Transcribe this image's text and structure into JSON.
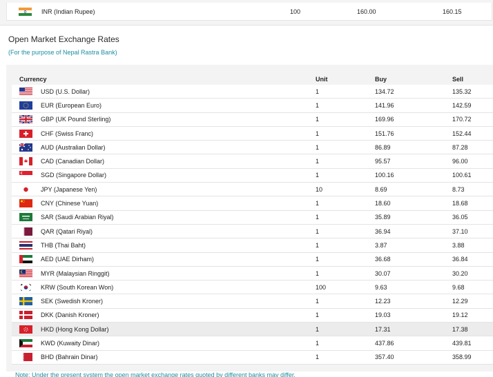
{
  "top_row": {
    "flag": "india-flag",
    "currency": "INR (Indian Rupee)",
    "unit": "100",
    "buy": "160.00",
    "sell": "160.15"
  },
  "section": {
    "title": "Open Market Exchange Rates",
    "subtitle": "(For the purpose of Nepal Rastra Bank)"
  },
  "table": {
    "headers": {
      "currency": "Currency",
      "unit": "Unit",
      "buy": "Buy",
      "sell": "Sell"
    },
    "rows": [
      {
        "flag": "usa-flag",
        "currency": "USD (U.S. Dollar)",
        "unit": "1",
        "buy": "134.72",
        "sell": "135.32"
      },
      {
        "flag": "eu-flag",
        "currency": "EUR (European Euro)",
        "unit": "1",
        "buy": "141.96",
        "sell": "142.59"
      },
      {
        "flag": "uk-flag",
        "currency": "GBP (UK Pound Sterling)",
        "unit": "1",
        "buy": "169.96",
        "sell": "170.72"
      },
      {
        "flag": "switzerland-flag",
        "currency": "CHF (Swiss Franc)",
        "unit": "1",
        "buy": "151.76",
        "sell": "152.44"
      },
      {
        "flag": "australia-flag",
        "currency": "AUD (Australian Dollar)",
        "unit": "1",
        "buy": "86.89",
        "sell": "87.28"
      },
      {
        "flag": "canada-flag",
        "currency": "CAD (Canadian Dollar)",
        "unit": "1",
        "buy": "95.57",
        "sell": "96.00"
      },
      {
        "flag": "singapore-flag",
        "currency": "SGD (Singapore Dollar)",
        "unit": "1",
        "buy": "100.16",
        "sell": "100.61"
      },
      {
        "flag": "japan-flag",
        "currency": "JPY (Japanese Yen)",
        "unit": "10",
        "buy": "8.69",
        "sell": "8.73"
      },
      {
        "flag": "china-flag",
        "currency": "CNY (Chinese Yuan)",
        "unit": "1",
        "buy": "18.60",
        "sell": "18.68"
      },
      {
        "flag": "saudi-arabia-flag",
        "currency": "SAR (Saudi Arabian Riyal)",
        "unit": "1",
        "buy": "35.89",
        "sell": "36.05"
      },
      {
        "flag": "qatar-flag",
        "currency": "QAR (Qatari Riyal)",
        "unit": "1",
        "buy": "36.94",
        "sell": "37.10"
      },
      {
        "flag": "thailand-flag",
        "currency": "THB (Thai Baht)",
        "unit": "1",
        "buy": "3.87",
        "sell": "3.88"
      },
      {
        "flag": "uae-flag",
        "currency": "AED (UAE Dirham)",
        "unit": "1",
        "buy": "36.68",
        "sell": "36.84"
      },
      {
        "flag": "malaysia-flag",
        "currency": "MYR (Malaysian Ringgit)",
        "unit": "1",
        "buy": "30.07",
        "sell": "30.20"
      },
      {
        "flag": "south-korea-flag",
        "currency": "KRW (South Korean Won)",
        "unit": "100",
        "buy": "9.63",
        "sell": "9.68"
      },
      {
        "flag": "sweden-flag",
        "currency": "SEK (Swedish Kroner)",
        "unit": "1",
        "buy": "12.23",
        "sell": "12.29"
      },
      {
        "flag": "denmark-flag",
        "currency": "DKK (Danish Kroner)",
        "unit": "1",
        "buy": "19.03",
        "sell": "19.12"
      },
      {
        "flag": "hong-kong-flag",
        "currency": "HKD (Hong Kong Dollar)",
        "unit": "1",
        "buy": "17.31",
        "sell": "17.38",
        "highlighted": true
      },
      {
        "flag": "kuwait-flag",
        "currency": "KWD (Kuwaity Dinar)",
        "unit": "1",
        "buy": "437.86",
        "sell": "439.81"
      },
      {
        "flag": "bahrain-flag",
        "currency": "BHD (Bahrain Dinar)",
        "unit": "1",
        "buy": "357.40",
        "sell": "358.99"
      }
    ]
  },
  "note": "Note: Under the present system the open market exchange rates quoted by different banks may differ.",
  "colors": {
    "accent": "#1a8fa0",
    "row_highlight": "#ececec",
    "panel_bg": "#f3f3f3"
  }
}
